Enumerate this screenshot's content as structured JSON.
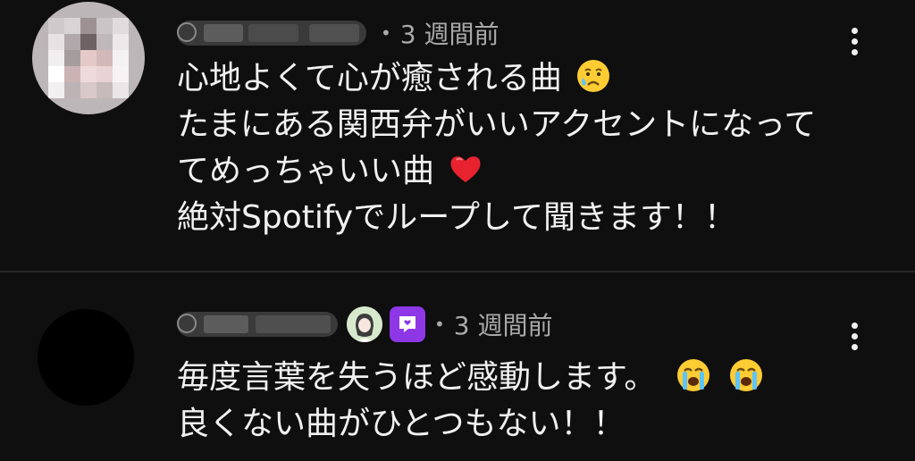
{
  "comments": [
    {
      "timestamp": "3 週間前",
      "separator": "•",
      "lines": [
        "心地よくて心が癒される曲",
        "たまにある関西弁がいいアクセントになって",
        "てめっちゃいい曲",
        "絶対Spotifyでループして聞きます！！"
      ],
      "emojis": [
        "crying-face",
        "red-heart"
      ]
    },
    {
      "timestamp": "3 週間前",
      "separator": "•",
      "lines": [
        "毎度言葉を失うほど感動します。",
        "良くない曲がひとつもない！！"
      ],
      "emojis": [
        "loudly-crying-face",
        "loudly-crying-face"
      ],
      "member_badge_color": "#8e37e6"
    }
  ],
  "colors": {
    "background": "#0f0f0f",
    "text": "#f1f1f1",
    "meta": "#aaaaaa",
    "divider": "#272727"
  }
}
